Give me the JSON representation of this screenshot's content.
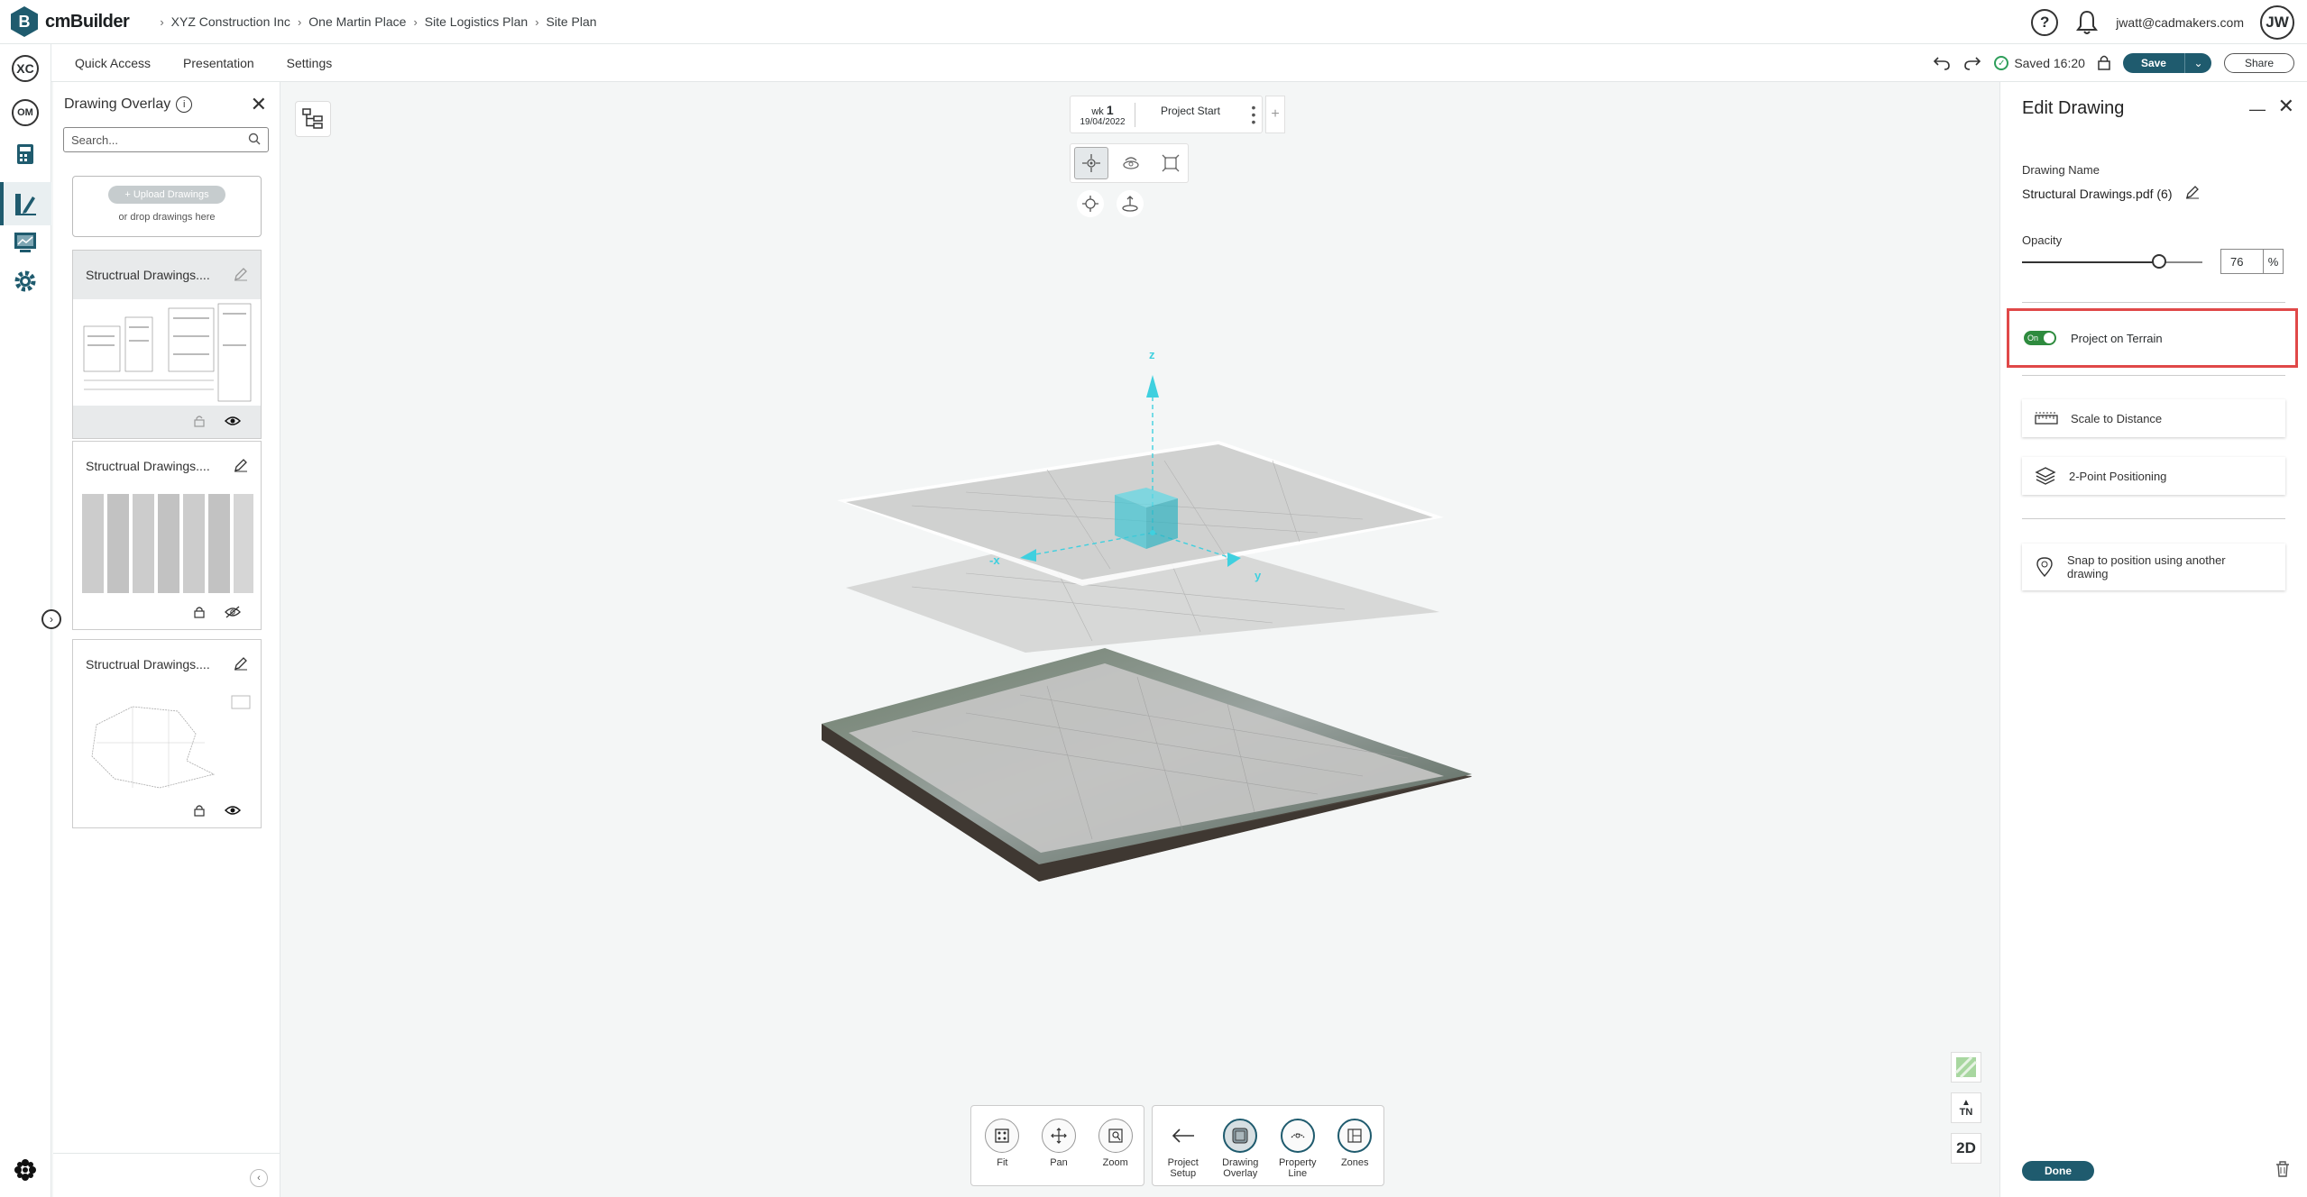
{
  "app": {
    "name": "cmBuilder"
  },
  "breadcrumb": [
    "XYZ Construction Inc",
    "One Martin Place",
    "Site Logistics Plan",
    "Site Plan"
  ],
  "header": {
    "user_email": "jwatt@cadmakers.com",
    "avatar_initials": "JW",
    "help": "?"
  },
  "rail": {
    "top_badge": "XC",
    "project_badge": "OM"
  },
  "menu": {
    "quick_access": "Quick Access",
    "presentation": "Presentation",
    "settings": "Settings"
  },
  "status": {
    "saved": "Saved 16:20",
    "save_label": "Save",
    "share_label": "Share"
  },
  "overlay": {
    "title": "Drawing Overlay",
    "search_placeholder": "Search...",
    "upload_label": "+ Upload Drawings",
    "upload_hint": "or drop drawings here",
    "cards": [
      {
        "name": "Structrual Drawings...."
      },
      {
        "name": "Structrual Drawings...."
      },
      {
        "name": "Structrual Drawings...."
      }
    ]
  },
  "timeline": {
    "wk_label": "wk",
    "wk_number": "1",
    "date": "19/04/2022",
    "project_start": "Project Start"
  },
  "scene": {
    "axis_z": "z",
    "axis_x": "-x",
    "axis_y": "y"
  },
  "map_tools": {
    "north": "TN",
    "view_mode": "2D"
  },
  "bottom_tools": {
    "fit": "Fit",
    "pan": "Pan",
    "zoom": "Zoom",
    "project_setup": [
      "Project",
      "Setup"
    ],
    "drawing_overlay": [
      "Drawing",
      "Overlay"
    ],
    "property_line": [
      "Property",
      "Line"
    ],
    "zones": "Zones"
  },
  "edit": {
    "title": "Edit Drawing",
    "name_label": "Drawing Name",
    "drawing_name": "Structural Drawings.pdf (6)",
    "opacity_label": "Opacity",
    "opacity_value": "76",
    "opacity_unit": "%",
    "toggle_label": "On",
    "project_on_terrain": "Project on Terrain",
    "scale_to_distance": "Scale to Distance",
    "two_point": "2-Point Positioning",
    "snap": [
      "Snap to position using another",
      "drawing"
    ],
    "done": "Done"
  },
  "colors": {
    "brand": "#1f5b6e",
    "highlight": "#e04848",
    "toggle_on": "#2e8b3e",
    "gizmo": "#3fd0df"
  }
}
